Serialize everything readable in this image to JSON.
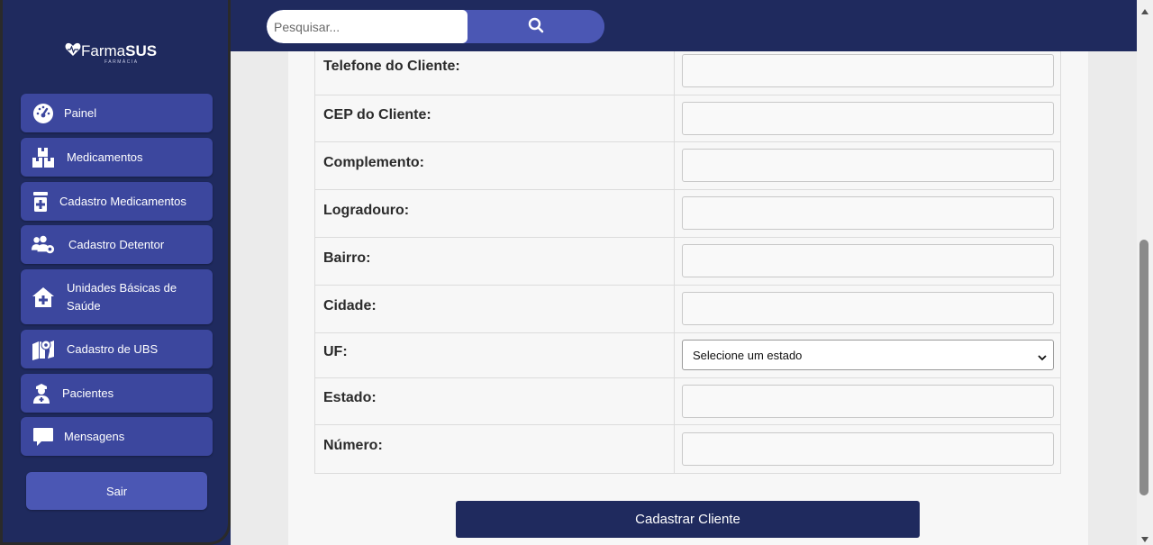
{
  "brand": {
    "name_light": "Farma",
    "name_bold": "SUS",
    "subtitle": "FARMÁCIA"
  },
  "search": {
    "placeholder": "Pesquisar...",
    "icon": "search-icon"
  },
  "sidebar": {
    "items": [
      {
        "label": "Painel",
        "icon": "dashboard-gauge-icon"
      },
      {
        "label": "Medicamentos",
        "icon": "boxes-icon"
      },
      {
        "label": "Cadastro Medicamentos",
        "icon": "pill-bottle-icon"
      },
      {
        "label": "Cadastro Detentor",
        "icon": "users-gear-icon"
      },
      {
        "label": "Unidades Básicas de Saúde",
        "icon": "house-medical-icon"
      },
      {
        "label": "Cadastro de UBS",
        "icon": "map-location-icon"
      },
      {
        "label": "Pacientes",
        "icon": "user-nurse-icon"
      },
      {
        "label": "Mensagens",
        "icon": "message-icon"
      }
    ],
    "logout_label": "Sair"
  },
  "form": {
    "fields": [
      {
        "label": "Telefone do Cliente:",
        "value": ""
      },
      {
        "label": "CEP do Cliente:",
        "value": ""
      },
      {
        "label": "Complemento:",
        "value": ""
      },
      {
        "label": "Logradouro:",
        "value": ""
      },
      {
        "label": "Bairro:",
        "value": ""
      },
      {
        "label": "Cidade:",
        "value": ""
      },
      {
        "label": "UF:",
        "value": "Selecione um estado"
      },
      {
        "label": "Estado:",
        "value": ""
      },
      {
        "label": "Número:",
        "value": ""
      }
    ],
    "submit_label": "Cadastrar Cliente"
  },
  "colors": {
    "navy": "#1f2a5e",
    "nav_button": "#3c479e",
    "accent": "#4b57b4"
  }
}
